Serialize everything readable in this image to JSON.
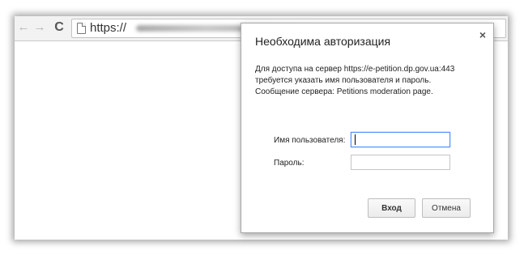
{
  "browser": {
    "url_prefix": "https://",
    "back_icon": "←",
    "forward_icon": "→",
    "reload_icon": "C"
  },
  "dialog": {
    "title": "Необходима авторизация",
    "close_glyph": "×",
    "message_lines": [
      "Для доступа на сервер https://e-petition.dp.gov.ua:443",
      "требуется указать имя пользователя и пароль.",
      "Сообщение сервера: Petitions moderation page."
    ],
    "username_label": "Имя пользователя:",
    "username_value": "",
    "password_label": "Пароль:",
    "password_value": "",
    "login_button": "Вход",
    "cancel_button": "Отмена"
  },
  "colors": {
    "focus_border": "#4d90fe",
    "toolbar_bg": "#f2f2f2"
  },
  "icons": {
    "back": "arrow-left-icon",
    "forward": "arrow-right-icon",
    "reload": "reload-icon",
    "page": "page-icon",
    "close": "close-icon"
  }
}
